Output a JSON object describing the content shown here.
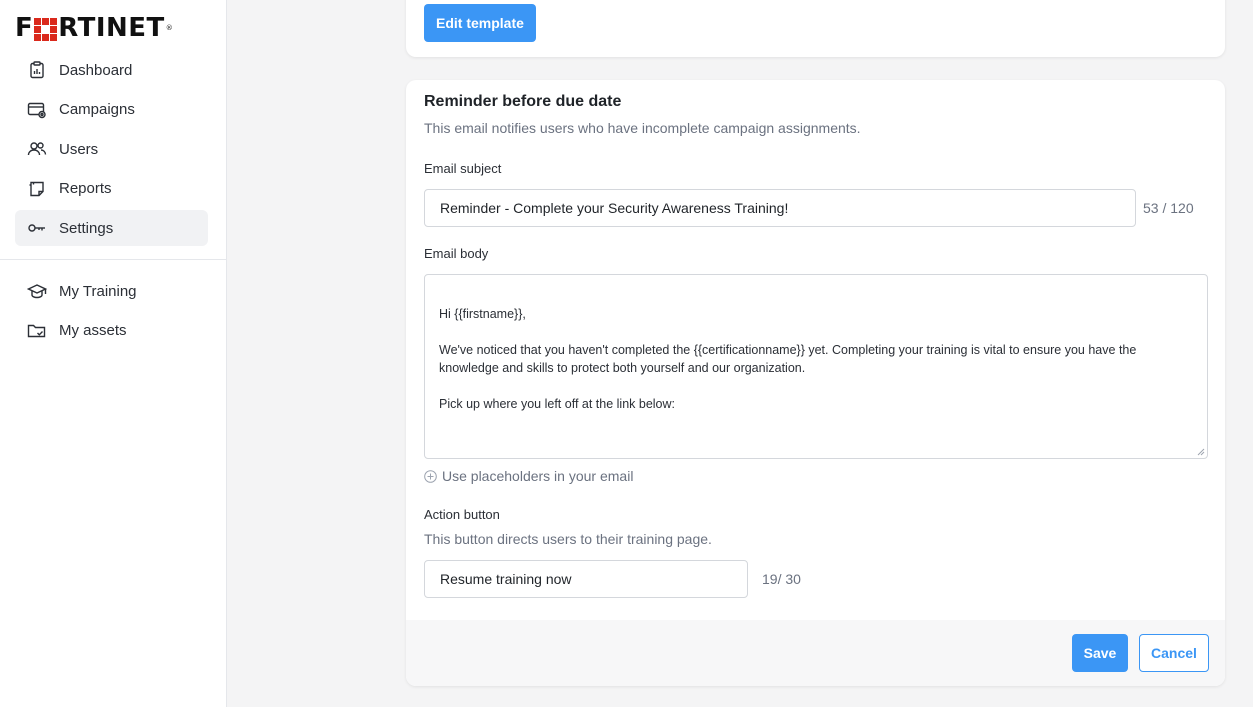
{
  "brand": {
    "logo_text_left": "F",
    "logo_text_right": "RTINET",
    "logo_reg": "®",
    "logo_color": "#da291c"
  },
  "sidebar": {
    "items": [
      {
        "label": "Dashboard",
        "icon": "dashboard-icon"
      },
      {
        "label": "Campaigns",
        "icon": "campaigns-icon"
      },
      {
        "label": "Users",
        "icon": "users-icon"
      },
      {
        "label": "Reports",
        "icon": "reports-icon"
      },
      {
        "label": "Settings",
        "icon": "settings-key-icon",
        "active": true
      }
    ],
    "secondary_items": [
      {
        "label": "My Training",
        "icon": "graduation-cap-icon"
      },
      {
        "label": "My assets",
        "icon": "folder-check-icon"
      }
    ]
  },
  "top_card": {
    "edit_template_label": "Edit template"
  },
  "reminder": {
    "title": "Reminder before due date",
    "description": "This email notifies users who have incomplete campaign assignments.",
    "subject": {
      "label": "Email subject",
      "value": "Reminder - Complete your Security Awareness Training!",
      "counter": "53 / 120"
    },
    "body": {
      "label": "Email body",
      "value": "Hi {{firstname}},\n\nWe've noticed that you haven't completed the {{certificationname}} yet. Completing your training is vital to ensure you have the knowledge and skills to protect both yourself and our organization.\n\nPick up where you left off at the link below:"
    },
    "placeholders_link": "Use placeholders in your email",
    "action_button": {
      "label": "Action button",
      "description": "This button directs users to their training page.",
      "value": "Resume training now",
      "counter": "19/ 30"
    }
  },
  "footer": {
    "save_label": "Save",
    "cancel_label": "Cancel"
  },
  "colors": {
    "primary": "#3b96f5",
    "active_nav_bg": "#f1f2f4"
  }
}
